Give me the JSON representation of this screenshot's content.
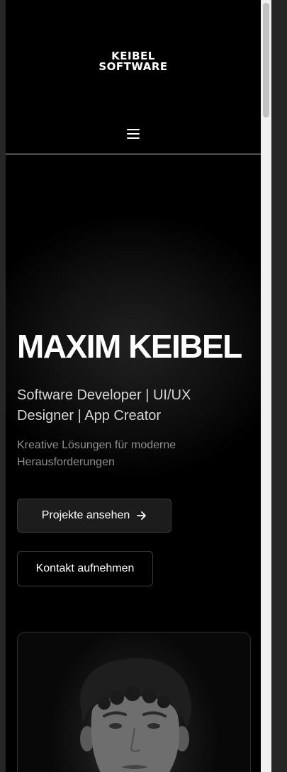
{
  "header": {
    "logo_line1": "KEIBEL",
    "logo_line2": "SOFTWARE"
  },
  "hero": {
    "title": "MAXIM KEIBEL",
    "subtitle": "Software Developer | UI/UX Designer | App Creator",
    "tagline": "Kreative Lösungen für moderne Herausforderungen",
    "primary_button": "Projekte ansehen",
    "secondary_button": "Kontakt aufnehmen"
  },
  "icons": {
    "menu": "hamburger-icon",
    "arrow": "arrow-right-icon"
  },
  "colors": {
    "background": "#000000",
    "text": "#ffffff",
    "muted": "#8f8f8f",
    "button_bg": "#1c1c1c",
    "border": "#3a3a3a"
  }
}
